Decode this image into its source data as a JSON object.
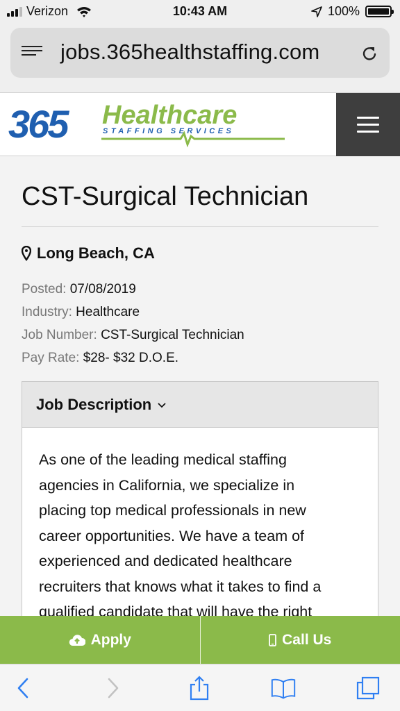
{
  "status_bar": {
    "carrier": "Verizon",
    "time": "10:43 AM",
    "battery": "100%"
  },
  "browser": {
    "url": "jobs.365healthstaffing.com"
  },
  "site": {
    "logo_number": "365",
    "logo_word": "Healthcare",
    "logo_tagline": "STAFFING SERVICES"
  },
  "job": {
    "title": "CST-Surgical Technician",
    "location": "Long Beach, CA",
    "meta": [
      {
        "label": "Posted:",
        "value": "07/08/2019"
      },
      {
        "label": "Industry:",
        "value": "Healthcare"
      },
      {
        "label": "Job Number:",
        "value": "CST-Surgical Technician"
      },
      {
        "label": "Pay Rate:",
        "value": "$28- $32 D.O.E."
      }
    ],
    "description_heading": "Job Description",
    "description_lines": [
      "As one of the leading medical staffing",
      "agencies in California, we specialize in",
      "placing top medical professionals in new",
      "career opportunities. We have a team of",
      "experienced and dedicated healthcare",
      "recruiters that knows what it takes to find a",
      "qualified candidate that will have the right"
    ]
  },
  "actions": {
    "apply_label": "Apply",
    "call_label": "Call Us"
  },
  "colors": {
    "brand_blue": "#1f5fb0",
    "brand_green": "#8bba4a",
    "header_dark": "#3e3e3e"
  },
  "icons": [
    "signal-icon",
    "wifi-icon",
    "location-arrow-icon",
    "battery-icon",
    "reader-icon",
    "reload-icon",
    "menu-icon",
    "map-pin-icon",
    "chevron-down-icon",
    "cloud-upload-icon",
    "phone-icon",
    "back-icon",
    "forward-icon",
    "share-icon",
    "bookmarks-icon",
    "tabs-icon"
  ]
}
